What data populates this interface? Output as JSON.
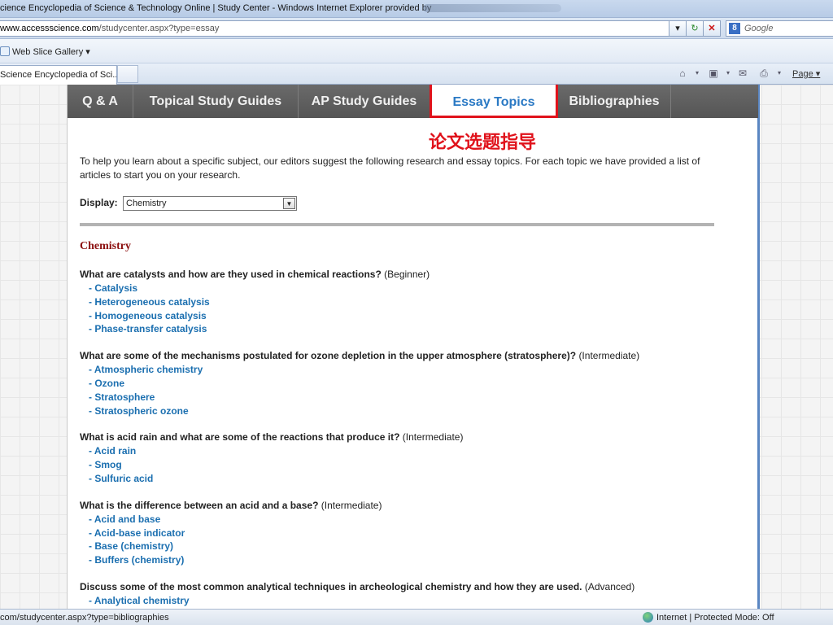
{
  "browser": {
    "title": "cience Encyclopedia of Science & Technology Online | Study Center - Windows Internet Explorer provided by",
    "url_domain": "www.accessscience.com",
    "url_path": "/studycenter.aspx?type=essay",
    "search_placeholder": "Google",
    "favorites_item": "Web Slice Gallery ▾",
    "tab_label": "Science Encyclopedia of Sci...",
    "page_menu": "Page ▾"
  },
  "nav": {
    "tabs": [
      {
        "label": "Q & A"
      },
      {
        "label": "Topical Study Guides"
      },
      {
        "label": "AP Study Guides"
      },
      {
        "label": "Essay Topics"
      },
      {
        "label": "Bibliographies"
      }
    ]
  },
  "annotation": "论文选题指导",
  "intro": "To help you learn about a specific subject, our editors suggest the following research and essay topics. For each topic we have provided a list of articles to start you on your research.",
  "display": {
    "label": "Display:",
    "selected": "Chemistry"
  },
  "section_title": "Chemistry",
  "topics": [
    {
      "question": "What are catalysts and how are they used in chemical reactions?",
      "level": "(Beginner)",
      "links": [
        "- Catalysis",
        "- Heterogeneous catalysis",
        "- Homogeneous catalysis",
        "- Phase-transfer catalysis"
      ]
    },
    {
      "question": "What are some of the mechanisms postulated for ozone depletion in the upper atmosphere (stratosphere)?",
      "level": "(Intermediate)",
      "links": [
        "- Atmospheric chemistry",
        "- Ozone",
        "- Stratosphere",
        "- Stratospheric ozone"
      ]
    },
    {
      "question": "What is acid rain and what are some of the reactions that produce it?",
      "level": "(Intermediate)",
      "links": [
        "- Acid rain",
        "- Smog",
        "- Sulfuric acid"
      ]
    },
    {
      "question": "What is the difference between an acid and a base?",
      "level": "(Intermediate)",
      "links": [
        "- Acid and base",
        "- Acid-base indicator",
        "- Base (chemistry)",
        "- Buffers (chemistry)"
      ]
    },
    {
      "question": "Discuss some of the most common analytical techniques in archeological chemistry and how they are used.",
      "level": "(Advanced)",
      "links": [
        "- Analytical chemistry"
      ]
    }
  ],
  "status": {
    "url": "com/studycenter.aspx?type=bibliographies",
    "zone": "Internet | Protected Mode: Off"
  }
}
